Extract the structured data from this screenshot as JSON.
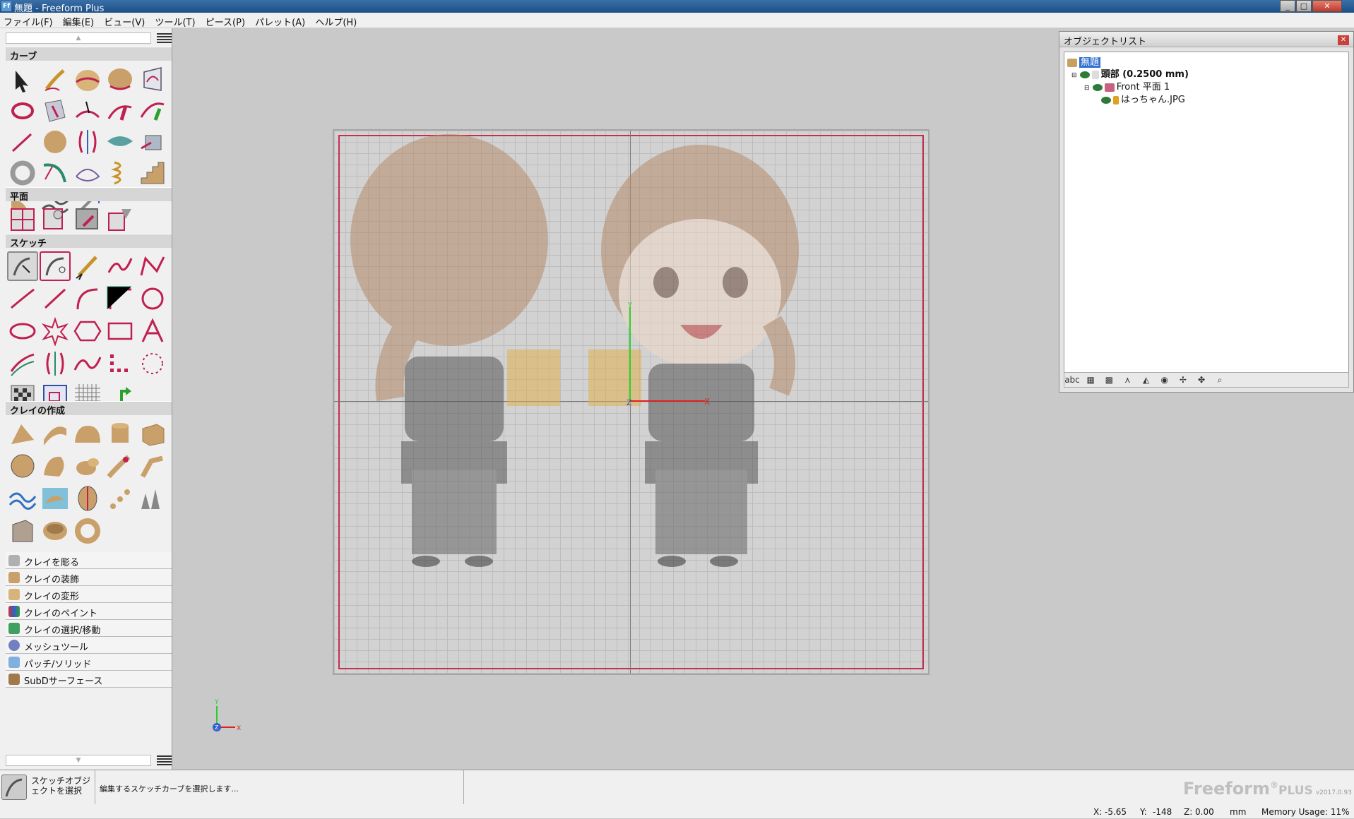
{
  "window": {
    "title": "無題 - Freeform Plus",
    "app_icon_text": "Ff"
  },
  "menu": [
    "ファイル(F)",
    "編集(E)",
    "ビュー(V)",
    "ツール(T)",
    "ピース(P)",
    "パレット(A)",
    "ヘルプ(H)"
  ],
  "left_panel": {
    "sections": {
      "curve": "カーブ",
      "plane": "平面",
      "sketch": "スケッチ",
      "clay": "クレイの作成"
    },
    "categories": [
      "クレイを彫る",
      "クレイの装飾",
      "クレイの変形",
      "クレイのペイント",
      "クレイの選択/移動",
      "メッシュツール",
      "パッチ/ソリッド",
      "SubDサーフェース"
    ]
  },
  "object_list": {
    "title": "オブジェクトリスト",
    "root": "無題",
    "piece": "頭部 (0.2500 mm)",
    "plane": "Front 平面 1",
    "image": "はっちゃん.JPG",
    "toolbar_text": "abc"
  },
  "viewport": {
    "axis_x": "X",
    "axis_y": "Y",
    "axis_z": "Z"
  },
  "status": {
    "tool_name": "スケッチオブジェクトを選択",
    "hint": "編集するスケッチカーブを選択します...",
    "x_label": "X:",
    "x_value": "-5.65",
    "y_label": "Y:",
    "y_value": "-148",
    "z_label": "Z:",
    "z_value": "0.00",
    "unit": "mm",
    "memory": "Memory Usage: 11%"
  },
  "brand": {
    "name": "Freeform",
    "reg": "®",
    "plus": "PLUS",
    "version": "v2017.0.93"
  }
}
